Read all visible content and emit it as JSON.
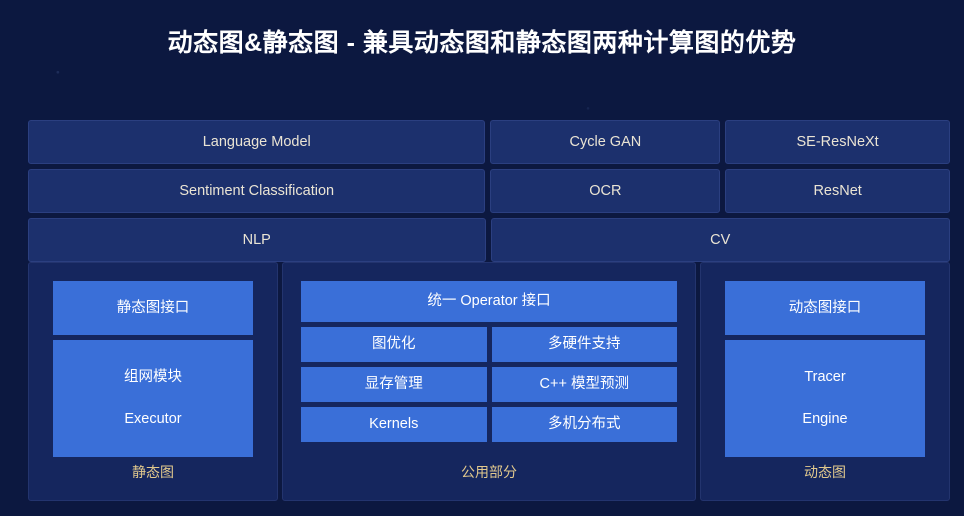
{
  "slide": {
    "title": "动态图&静态图 - 兼具动态图和静态图两种计算图的优势",
    "background_color": "#0c1840",
    "accent_block_color": "#3a6fd8",
    "top_cell_color": "#1c306d",
    "panel_color": "#15265e",
    "label_color": "#e2c98d",
    "top_text_color": "#eae4d4"
  },
  "top_stack": {
    "row1": {
      "nlp_app": "Language Model",
      "cv_app_1": "Cycle  GAN",
      "cv_app_2": "SE-ResNeXt"
    },
    "row2": {
      "nlp_app": "Sentiment Classification",
      "cv_app_1": "OCR",
      "cv_app_2": "ResNet"
    },
    "row3": {
      "nlp_domain": "NLP",
      "cv_domain": "CV"
    }
  },
  "panels": {
    "static_graph": {
      "api_block": "静态图接口",
      "body_line_1": "组网模块",
      "body_line_2": "Executor",
      "label": "静态图"
    },
    "common": {
      "operator_block": "统一 Operator 接口",
      "grid": [
        "图优化",
        "多硬件支持",
        "显存管理",
        "C++ 模型预测",
        "Kernels",
        "多机分布式"
      ],
      "label": "公用部分"
    },
    "dynamic_graph": {
      "api_block": "动态图接口",
      "body_line_1": "Tracer",
      "body_line_2": "Engine",
      "label": "动态图"
    }
  }
}
